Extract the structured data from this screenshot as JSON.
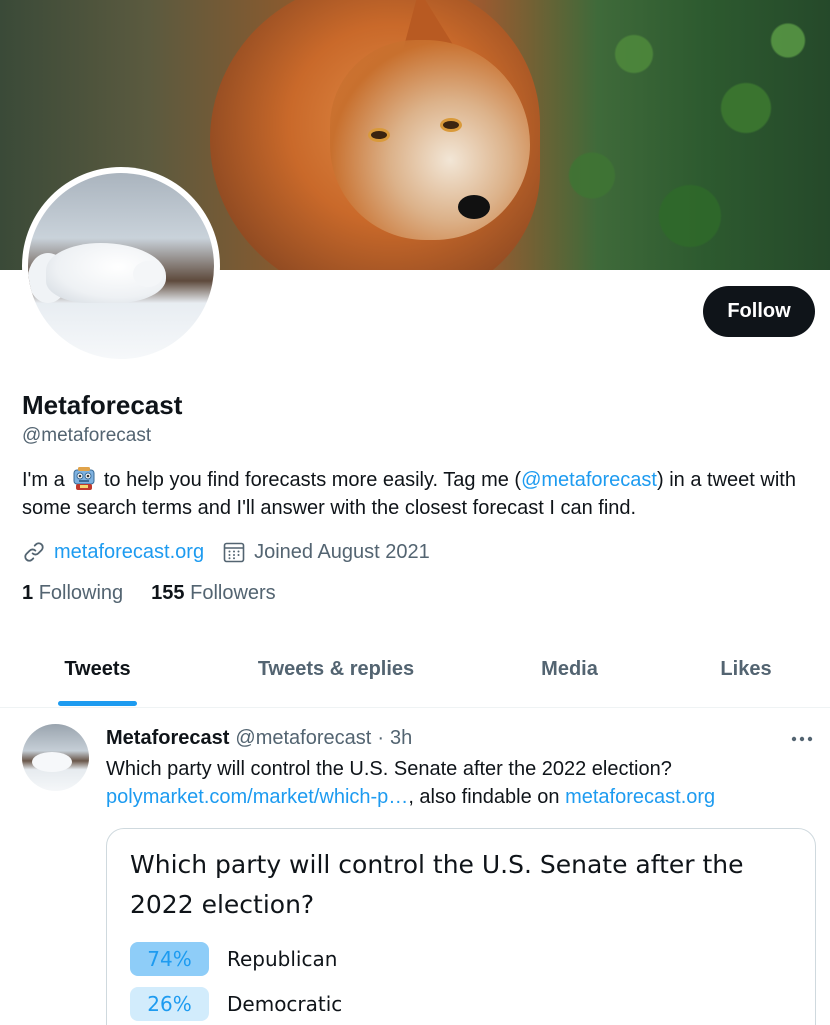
{
  "profile": {
    "name": "Metaforecast",
    "handle": "@metaforecast",
    "follow_label": "Follow",
    "bio_prefix": "I'm a",
    "bio_after_emoji": " to help you find forecasts more easily. Tag me (",
    "bio_mention": "@metaforecast",
    "bio_suffix": ") in a tweet with some search terms and I'll answer with the closest forecast I can find.",
    "bio_emoji": "robot-emoji",
    "website": "metaforecast.org",
    "joined": "Joined August 2021",
    "following_count": "1",
    "following_label": "Following",
    "followers_count": "155",
    "followers_label": "Followers"
  },
  "tabs": [
    {
      "label": "Tweets",
      "active": true
    },
    {
      "label": "Tweets & replies",
      "active": false
    },
    {
      "label": "Media",
      "active": false
    },
    {
      "label": "Likes",
      "active": false
    }
  ],
  "tweet": {
    "author_name": "Metaforecast",
    "author_handle": "@metaforecast",
    "separator": "·",
    "time": "3h",
    "text": "Which party will control the U.S. Senate after the 2022 election?",
    "link": "polymarket.com/market/which-p…",
    "text_mid": ", also findable on ",
    "link2": "metaforecast.org",
    "card": {
      "title": "Which party will control the U.S. Senate after the 2022 election?",
      "options": [
        {
          "pct": "74%",
          "label": "Republican",
          "value": 74
        },
        {
          "pct": "26%",
          "label": "Democratic",
          "value": 26
        }
      ]
    }
  },
  "icons": {
    "link": "link-icon",
    "calendar": "calendar-icon",
    "more": "more-icon"
  },
  "colors": {
    "accent": "#1d9bf0",
    "text": "#0f1419",
    "muted": "#536471",
    "option_high": "#8ecdf8",
    "option_low": "#d2ecfc"
  }
}
